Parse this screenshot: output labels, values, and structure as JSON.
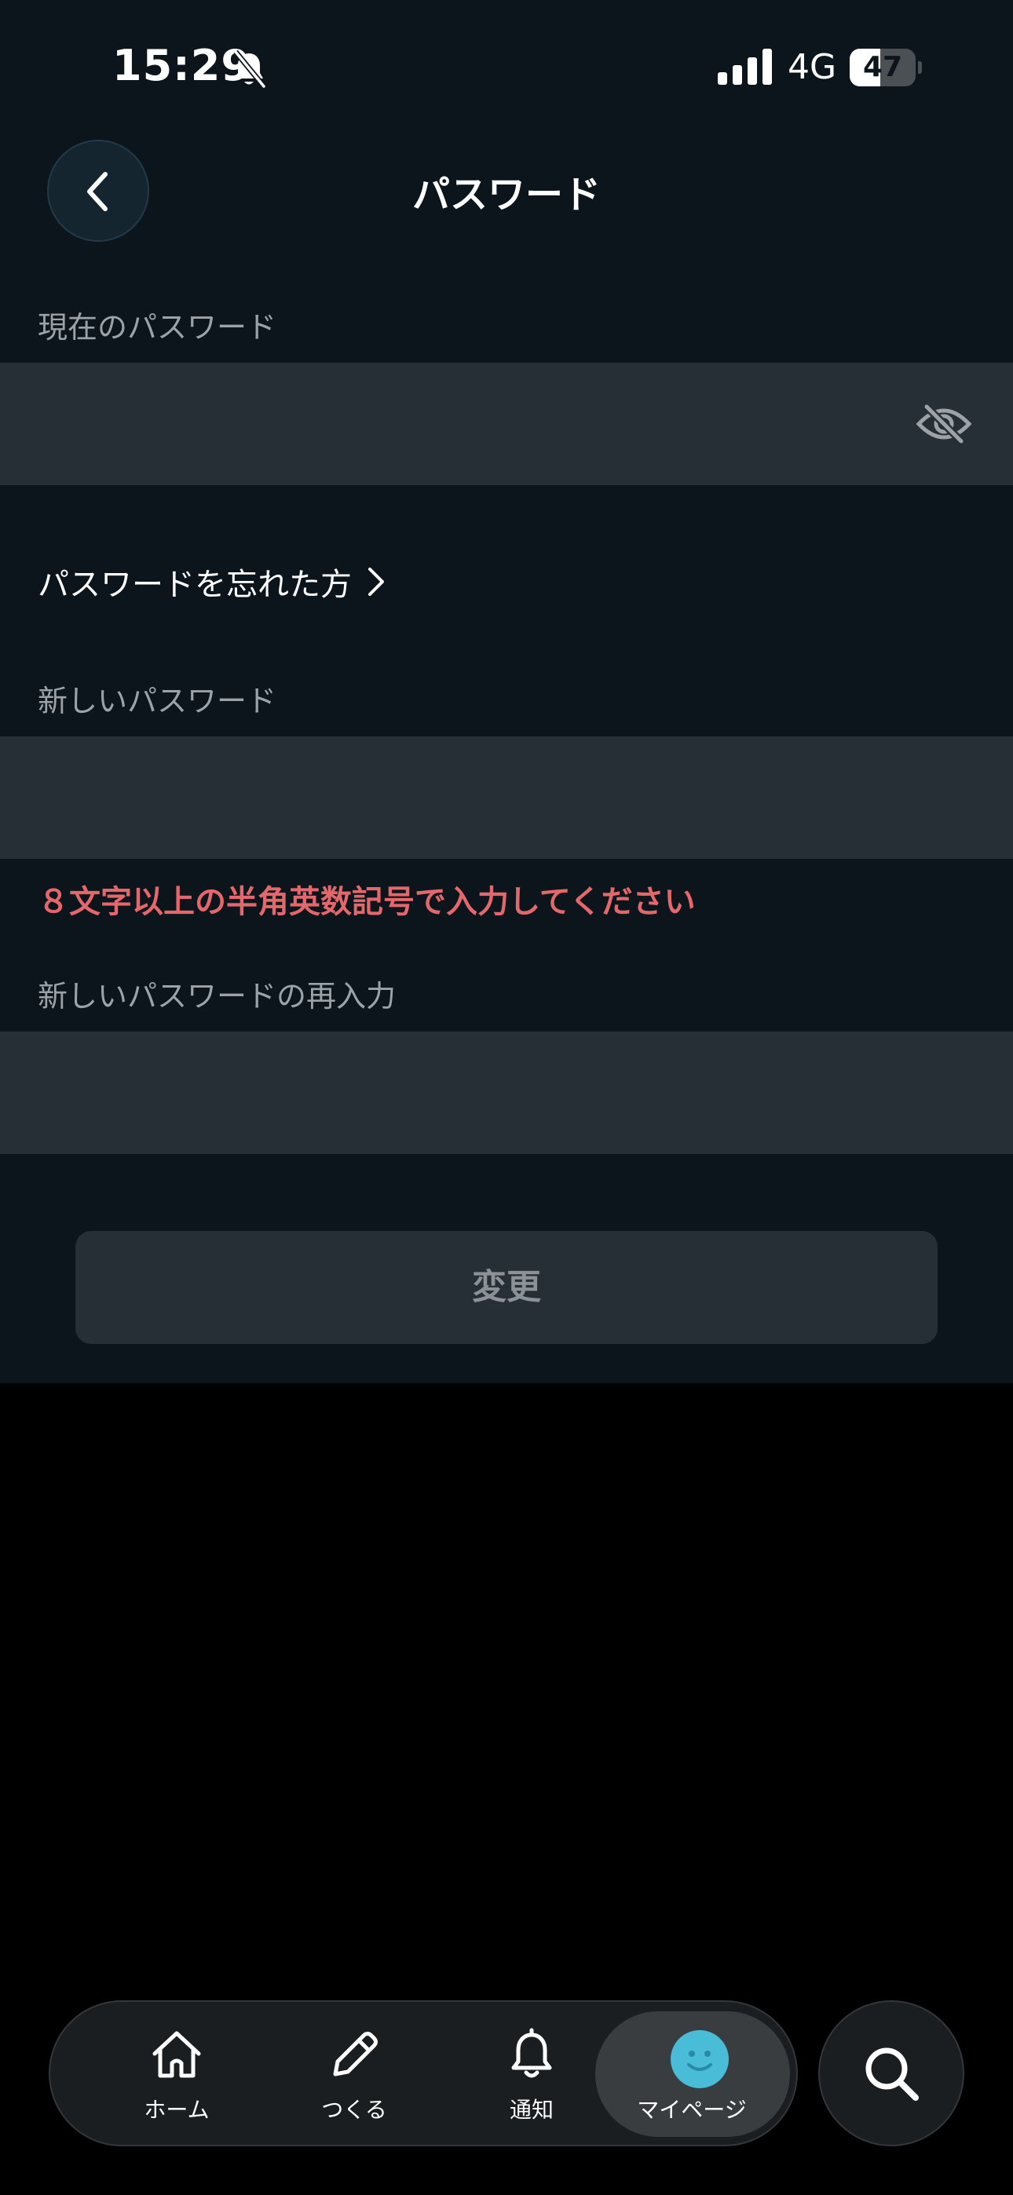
{
  "status_bar": {
    "time": "15:29",
    "network": "4G",
    "battery": "47",
    "battery_level": 0.47
  },
  "header": {
    "title": "パスワード"
  },
  "form": {
    "current_password_label": "現在のパスワード",
    "current_password_value": "",
    "forgot_password_link": "パスワードを忘れた方",
    "new_password_label": "新しいパスワード",
    "new_password_value": "",
    "error_message": "８文字以上の半角英数記号で入力してください",
    "confirm_password_label": "新しいパスワードの再入力",
    "confirm_password_value": "",
    "submit_label": "変更"
  },
  "tabbar": {
    "items": [
      {
        "label": "ホーム",
        "icon": "home-icon"
      },
      {
        "label": "つくる",
        "icon": "pencil-icon"
      },
      {
        "label": "通知",
        "icon": "bell-icon"
      },
      {
        "label": "マイページ",
        "icon": "avatar-smile-icon",
        "active": true
      }
    ],
    "search_icon": "search-icon"
  },
  "colors": {
    "background": "#0c151c",
    "field": "#262e36",
    "error": "#e4686b",
    "avatar": "#49bcd8"
  }
}
